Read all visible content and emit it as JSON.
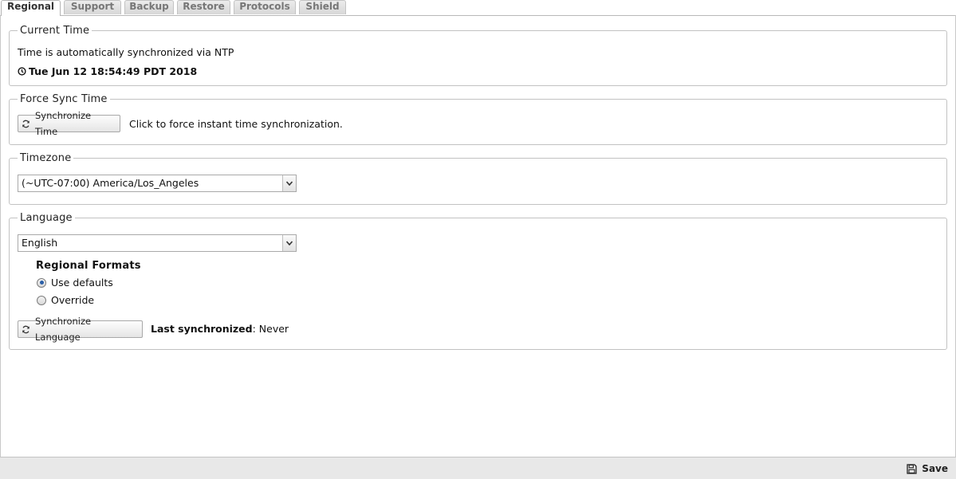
{
  "tabs": [
    {
      "label": "Regional",
      "active": true
    },
    {
      "label": "Support",
      "active": false
    },
    {
      "label": "Backup",
      "active": false
    },
    {
      "label": "Restore",
      "active": false
    },
    {
      "label": "Protocols",
      "active": false
    },
    {
      "label": "Shield",
      "active": false
    }
  ],
  "current_time": {
    "legend": "Current Time",
    "description": "Time is automatically synchronized via NTP",
    "datetime": "Tue Jun 12 18:54:49 PDT 2018",
    "icon": "clock-icon"
  },
  "force_sync": {
    "legend": "Force Sync Time",
    "button_label": "Synchronize Time",
    "help_text": "Click to force instant time synchronization.",
    "icon": "refresh-icon"
  },
  "timezone": {
    "legend": "Timezone",
    "selected": "(~UTC-07:00) America/Los_Angeles"
  },
  "language": {
    "legend": "Language",
    "selected": "English",
    "regional_formats": {
      "heading": "Regional Formats",
      "options": [
        {
          "label": "Use defaults",
          "checked": true
        },
        {
          "label": "Override",
          "checked": false
        }
      ]
    },
    "sync_button_label": "Synchronize Language",
    "last_sync_label": "Last synchronized",
    "last_sync_value": ": Never"
  },
  "footer": {
    "save_label": "Save",
    "icon": "floppy-disk-icon"
  }
}
